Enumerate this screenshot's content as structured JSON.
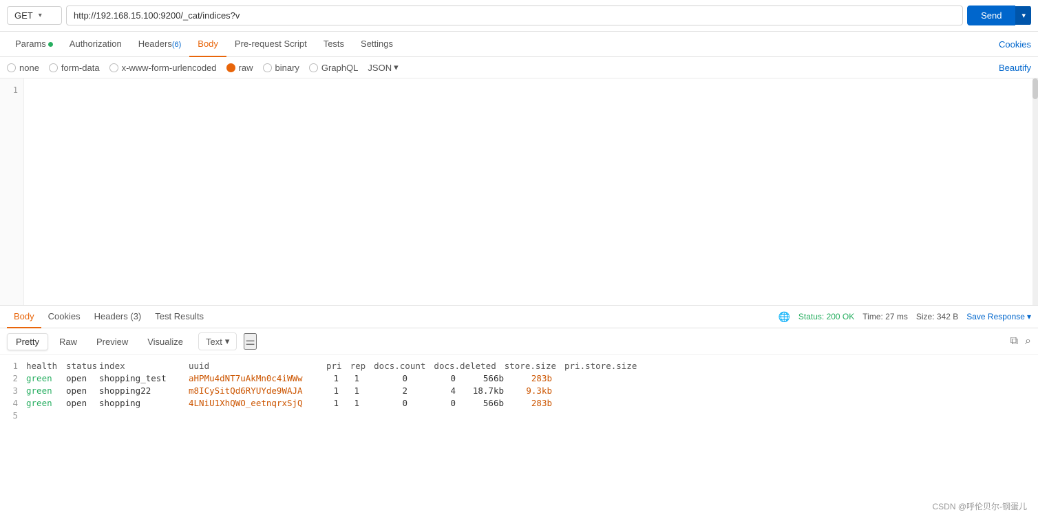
{
  "urlBar": {
    "method": "GET",
    "url": "http://192.168.15.100:9200/_cat/indices?v",
    "sendLabel": "Send"
  },
  "reqTabs": [
    {
      "id": "params",
      "label": "Params",
      "hasDot": true
    },
    {
      "id": "authorization",
      "label": "Authorization",
      "hasDot": false
    },
    {
      "id": "headers",
      "label": "Headers",
      "badge": "(6)",
      "hasDot": false
    },
    {
      "id": "body",
      "label": "Body",
      "hasDot": false,
      "active": true
    },
    {
      "id": "prerequest",
      "label": "Pre-request Script",
      "hasDot": false
    },
    {
      "id": "tests",
      "label": "Tests",
      "hasDot": false
    },
    {
      "id": "settings",
      "label": "Settings",
      "hasDot": false
    }
  ],
  "cookiesLabel": "Cookies",
  "bodyTypes": [
    {
      "id": "none",
      "label": "none",
      "active": false
    },
    {
      "id": "form-data",
      "label": "form-data",
      "active": false
    },
    {
      "id": "x-www-form-urlencoded",
      "label": "x-www-form-urlencoded",
      "active": false
    },
    {
      "id": "raw",
      "label": "raw",
      "active": true
    },
    {
      "id": "binary",
      "label": "binary",
      "active": false
    },
    {
      "id": "graphql",
      "label": "GraphQL",
      "active": false
    }
  ],
  "jsonLabel": "JSON",
  "beautifyLabel": "Beautify",
  "editorLineNumbers": [
    "1"
  ],
  "editorContent": "",
  "respTabs": [
    {
      "id": "body",
      "label": "Body",
      "active": true
    },
    {
      "id": "cookies",
      "label": "Cookies"
    },
    {
      "id": "headers",
      "label": "Headers (3)"
    },
    {
      "id": "testresults",
      "label": "Test Results"
    }
  ],
  "responseStatus": {
    "statusText": "Status: 200 OK",
    "timeText": "Time: 27 ms",
    "sizeText": "Size: 342 B",
    "saveResponseLabel": "Save Response"
  },
  "viewButtons": [
    {
      "id": "pretty",
      "label": "Pretty",
      "active": true
    },
    {
      "id": "raw",
      "label": "Raw"
    },
    {
      "id": "preview",
      "label": "Preview"
    },
    {
      "id": "visualize",
      "label": "Visualize"
    }
  ],
  "textDropdown": "Text",
  "responseData": {
    "headers": {
      "health": "health",
      "status": "status",
      "index": "index",
      "uuid": "uuid",
      "pri": "pri",
      "rep": "rep",
      "docsCount": "docs.count",
      "docsDeleted": "docs.deleted",
      "storeSize": "store.size",
      "priStoreSize": "pri.store.size"
    },
    "rows": [
      {
        "ln": 2,
        "health": "green",
        "status": "open",
        "index": "shopping_test",
        "uuid": "aHPMu4dNT7uAkMn0c4iWWw",
        "pri": "1",
        "rep": "1",
        "docsCount": "0",
        "docsDeleted": "0",
        "storeSize": "566b",
        "priStoreSize": "283b"
      },
      {
        "ln": 3,
        "health": "green",
        "status": "open",
        "index": "shopping22",
        "uuid": "m8ICySitQd6RYUYde9WAJA",
        "pri": "1",
        "rep": "1",
        "docsCount": "2",
        "docsDeleted": "4",
        "storeSize": "18.7kb",
        "priStoreSize": "9.3kb"
      },
      {
        "ln": 4,
        "health": "green",
        "status": "open",
        "index": "shopping",
        "uuid": "4LNiU1XhQWO_eetnqrxSjQ",
        "pri": "1",
        "rep": "1",
        "docsCount": "0",
        "docsDeleted": "0",
        "storeSize": "566b",
        "priStoreSize": "283b"
      }
    ],
    "lastLn": 5
  },
  "watermark": "CSDN @呼伦贝尔-钢蛋儿"
}
